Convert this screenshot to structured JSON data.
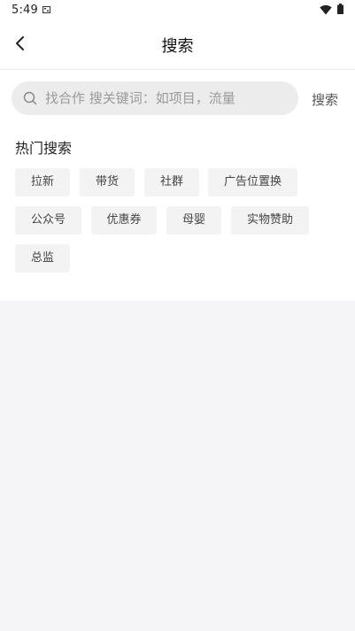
{
  "status_bar": {
    "time": "5:49"
  },
  "header": {
    "title": "搜索"
  },
  "search": {
    "placeholder": "找合作 搜关键词：如项目，流量",
    "button_label": "搜索"
  },
  "hot_search": {
    "title": "热门搜索",
    "tags": [
      "拉新",
      "带货",
      "社群",
      "广告位置换",
      "公众号",
      "优惠券",
      "母婴",
      "实物赞助",
      "总监"
    ]
  },
  "icons": {
    "back": "chevron-left-icon",
    "search": "search-icon",
    "wifi": "wifi-icon",
    "battery": "battery-icon",
    "notification": "notification-icon"
  },
  "colors": {
    "page_background": "#f5f5f7",
    "card_background": "#ffffff",
    "search_field": "#ececec",
    "tag_background": "#f3f3f3",
    "placeholder_text": "#9a9a9a"
  }
}
